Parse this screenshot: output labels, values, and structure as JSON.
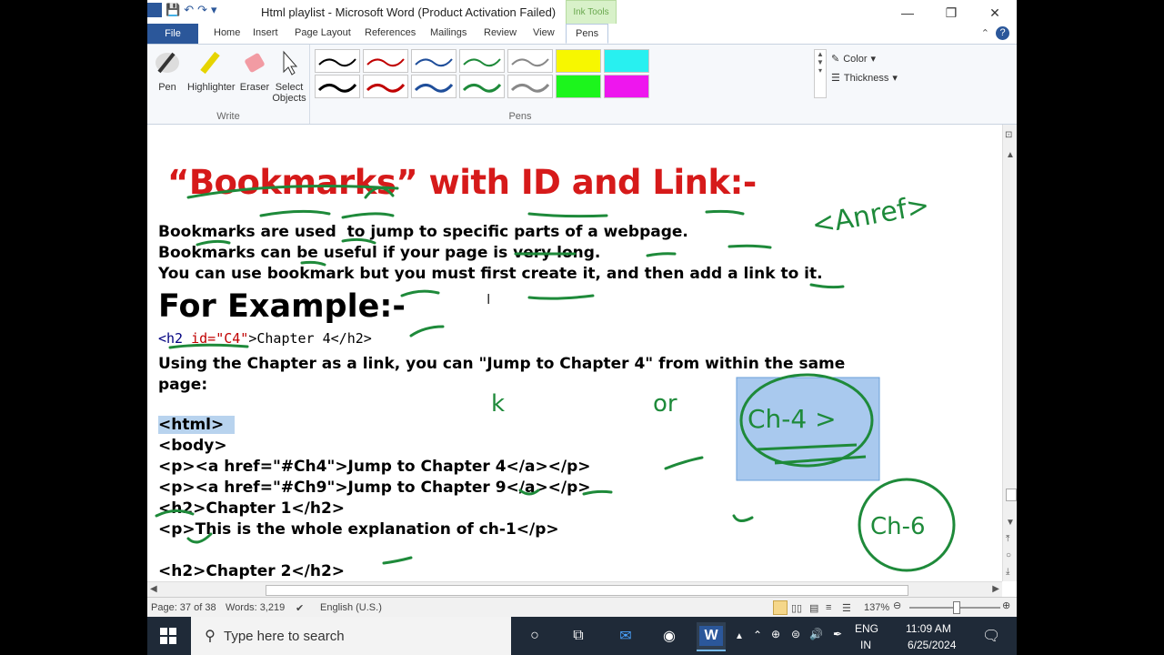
{
  "window": {
    "title": "Html playlist  -  Microsoft Word (Product Activation Failed)",
    "context_tab": "Ink Tools",
    "controls": {
      "minimize": "—",
      "restore": "❐",
      "close": "✕"
    }
  },
  "tabs": [
    "File",
    "Home",
    "Insert",
    "Page Layout",
    "References",
    "Mailings",
    "Review",
    "View",
    "Pens"
  ],
  "ribbon": {
    "write_group": {
      "label": "Write",
      "tools": [
        "Pen",
        "Highlighter",
        "Eraser",
        "Select Objects"
      ]
    },
    "pens_group": {
      "label": "Pens"
    },
    "color_label": "Color",
    "thickness_label": "Thickness"
  },
  "document": {
    "heading": "“Bookmarks” with ID and Link:-",
    "para1": "Bookmarks are used  to jump to specific parts of a webpage.",
    "para2": "Bookmarks can be useful if your page is very long.",
    "para3": "You can use bookmark but you must first create it, and then add a link to it.",
    "example": "For Example:-",
    "code1_open": "<h2 ",
    "code1_attr": "id=",
    "code1_val": "\"C4\"",
    "code1_rest": ">Chapter 4</h2>",
    "using1": "Using the Chapter as a link, you can \"Jump to Chapter 4\" from within the same",
    "using2": "page:",
    "code_lines": [
      "<html>",
      "<body>",
      "<p><a href=\"#Ch4\">Jump to Chapter 4</a></p>",
      "<p><a href=\"#Ch9\">Jump to Chapter 9</a></p>",
      "<h2>Chapter 1</h2>",
      "<p>This is the whole explanation of ch-1</p>",
      "",
      "<h2>Chapter 2</h2>"
    ]
  },
  "ink": {
    "anref": "<Anref>",
    "ch4": "Ch-4 >",
    "ch6": "Ch-6",
    "k": "k",
    "or": "or"
  },
  "statusbar": {
    "page": "Page: 37 of 38",
    "words": "Words: 3,219",
    "language": "English (U.S.)",
    "zoom": "137%"
  },
  "taskbar": {
    "search_placeholder": "Type here to search",
    "lang_top": "ENG",
    "lang_bottom": "IN",
    "time": "11:09 AM",
    "date": "6/25/2024"
  },
  "colors": {
    "accent": "#2b579a",
    "heading": "#d61a1a",
    "ink": "#1e8a3a",
    "taskbar": "#1f2a38"
  }
}
